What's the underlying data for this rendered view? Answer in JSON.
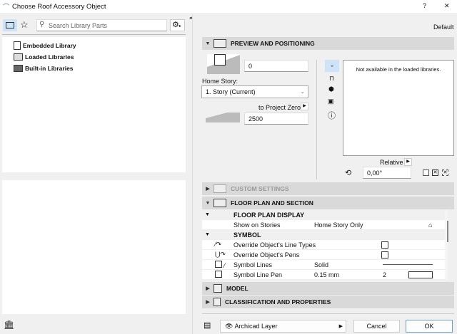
{
  "window": {
    "title": "Choose Roof Accessory Object",
    "help": "?",
    "close": "✕"
  },
  "left": {
    "search_placeholder": "Search Library Parts",
    "tree": [
      {
        "label": "Embedded Library"
      },
      {
        "label": "Loaded Libraries"
      },
      {
        "label": "Built-in Libraries"
      }
    ]
  },
  "right": {
    "default_label": "Default",
    "preview": {
      "title": "PREVIEW AND POSITIONING",
      "elevation": "0",
      "home_story_label": "Home Story:",
      "home_story": "1. Story (Current)",
      "to_project_zero": "to Project Zero",
      "project_zero_value": "2500",
      "not_available": "Not available in the loaded libraries.",
      "relative": "Relative",
      "angle": "0,00°"
    },
    "custom_settings": "CUSTOM SETTINGS",
    "floor_plan": {
      "title": "FLOOR PLAN AND SECTION",
      "display_group": "FLOOR PLAN DISPLAY",
      "show_on_stories_label": "Show on Stories",
      "show_on_stories_value": "Home Story Only",
      "symbol_group": "SYMBOL",
      "override_line_types": "Override Object's Line Types",
      "override_pens": "Override Object's Pens",
      "symbol_lines_label": "Symbol Lines",
      "symbol_lines_value": "Solid",
      "symbol_line_pen_label": "Symbol Line Pen",
      "symbol_line_pen_value": "0.15 mm",
      "symbol_line_pen_num": "2"
    },
    "model": "MODEL",
    "classification": "CLASSIFICATION AND PROPERTIES",
    "layer": "Archicad Layer",
    "cancel": "Cancel",
    "ok": "OK"
  }
}
